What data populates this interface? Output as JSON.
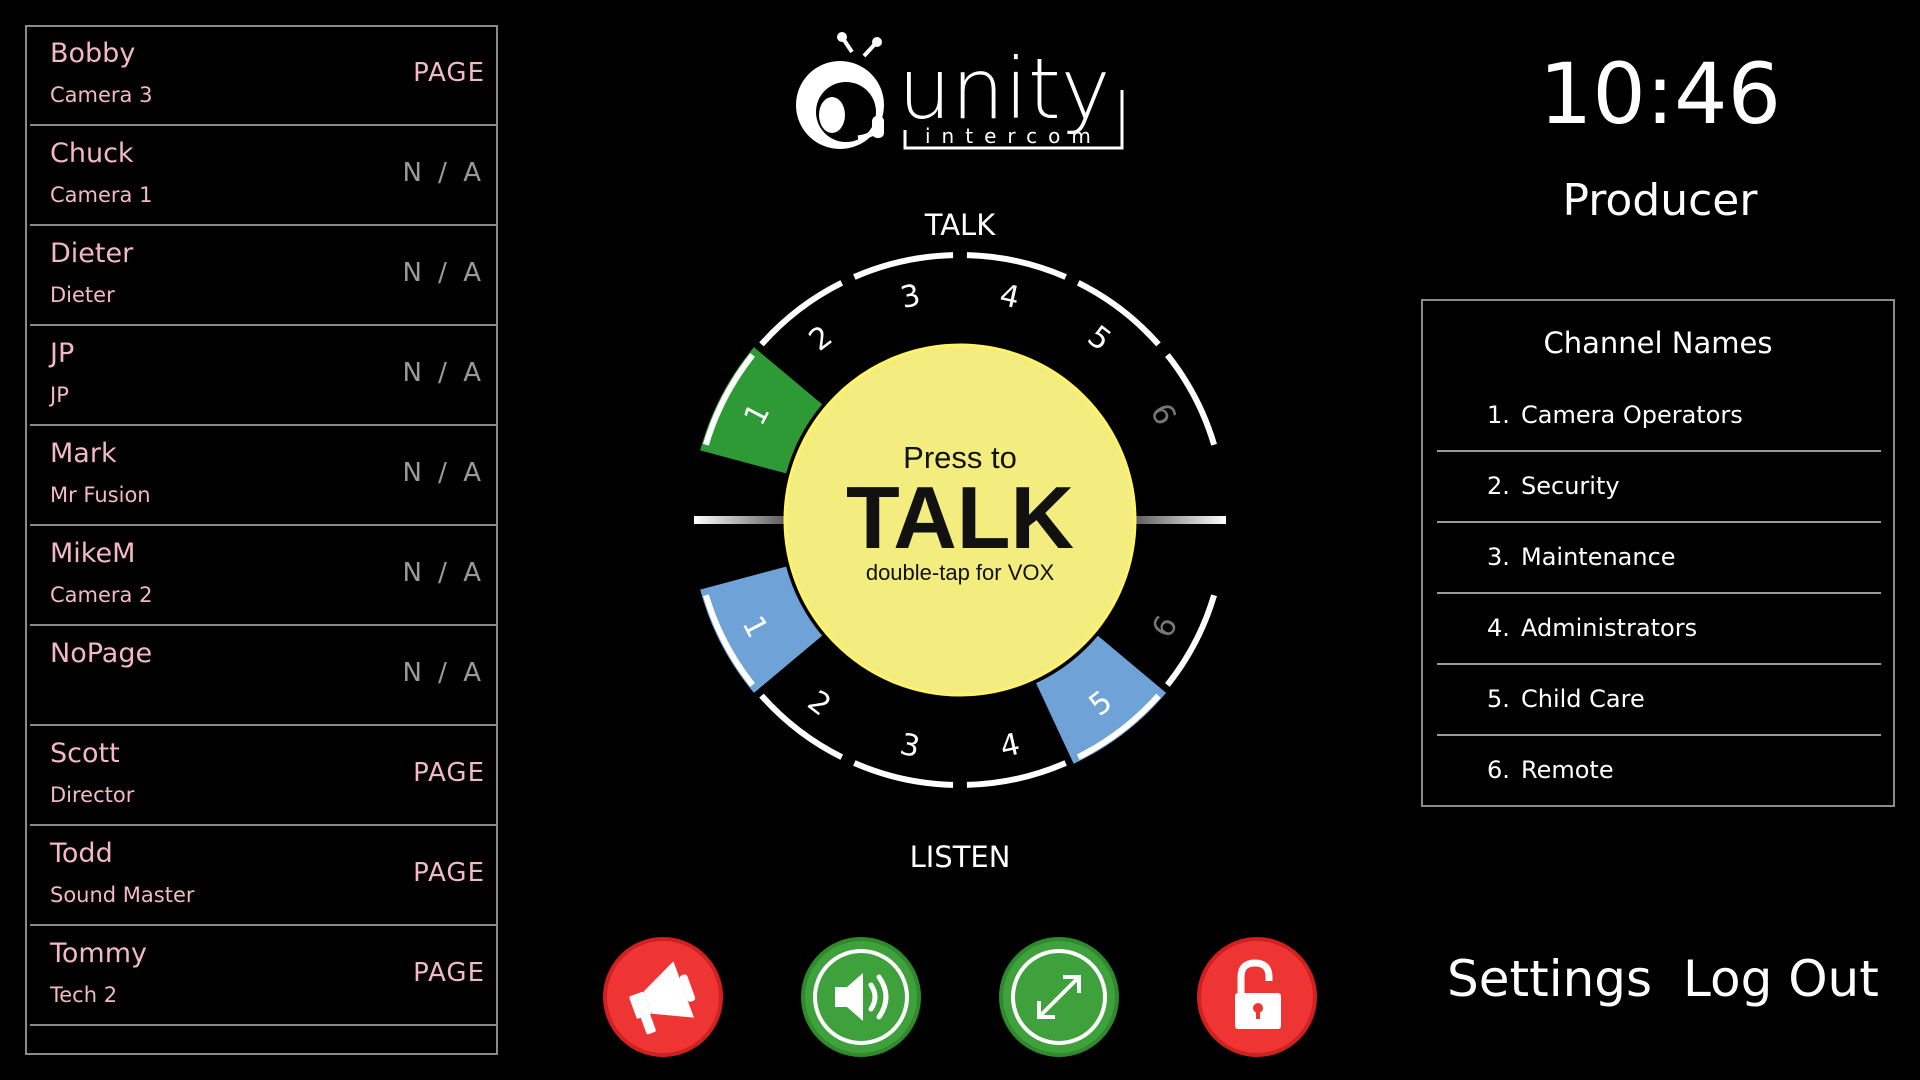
{
  "users": [
    {
      "name": "Bobby",
      "sub": "Camera 3",
      "status": "PAGE"
    },
    {
      "name": "Chuck",
      "sub": "Camera 1",
      "status": "N / A"
    },
    {
      "name": "Dieter",
      "sub": "Dieter",
      "status": "N / A"
    },
    {
      "name": "JP",
      "sub": "JP",
      "status": "N / A"
    },
    {
      "name": "Mark",
      "sub": "Mr Fusion",
      "status": "N / A"
    },
    {
      "name": "MikeM",
      "sub": "Camera 2",
      "status": "N / A"
    },
    {
      "name": "NoPage",
      "sub": "",
      "status": "N / A"
    },
    {
      "name": "Scott",
      "sub": "Director",
      "status": "PAGE"
    },
    {
      "name": "Todd",
      "sub": "Sound Master",
      "status": "PAGE"
    },
    {
      "name": "Tommy",
      "sub": "Tech 2",
      "status": "PAGE"
    }
  ],
  "logo": {
    "word": "unity",
    "sub": "intercom"
  },
  "dial": {
    "talk_label": "TALK",
    "listen_label": "LISTEN",
    "press_to": "Press to",
    "talk_big": "TALK",
    "vox_hint": "double-tap for VOX",
    "talk_channels": [
      "1",
      "2",
      "3",
      "4",
      "5",
      "6"
    ],
    "listen_channels": [
      "1",
      "2",
      "3",
      "4",
      "5",
      "6"
    ],
    "talk_active": [
      1
    ],
    "listen_active": [
      1,
      5
    ]
  },
  "colors": {
    "talk_active": "#2e9a36",
    "listen_active": "#6fa3d8",
    "button_face": "#f3ec7e",
    "name_text": "#f2b8c6"
  },
  "clock": "10:46",
  "role": "Producer",
  "channel_panel": {
    "title": "Channel Names",
    "channels": [
      {
        "num": "1.",
        "name": "Camera Operators"
      },
      {
        "num": "2.",
        "name": "Security"
      },
      {
        "num": "3.",
        "name": "Maintenance"
      },
      {
        "num": "4.",
        "name": "Administrators"
      },
      {
        "num": "5.",
        "name": "Child Care"
      },
      {
        "num": "6.",
        "name": "Remote"
      }
    ]
  },
  "buttons": {
    "icons": [
      "megaphone-icon",
      "speaker-icon",
      "expand-icon",
      "unlock-icon"
    ],
    "settings": "Settings",
    "logout": "Log Out"
  }
}
